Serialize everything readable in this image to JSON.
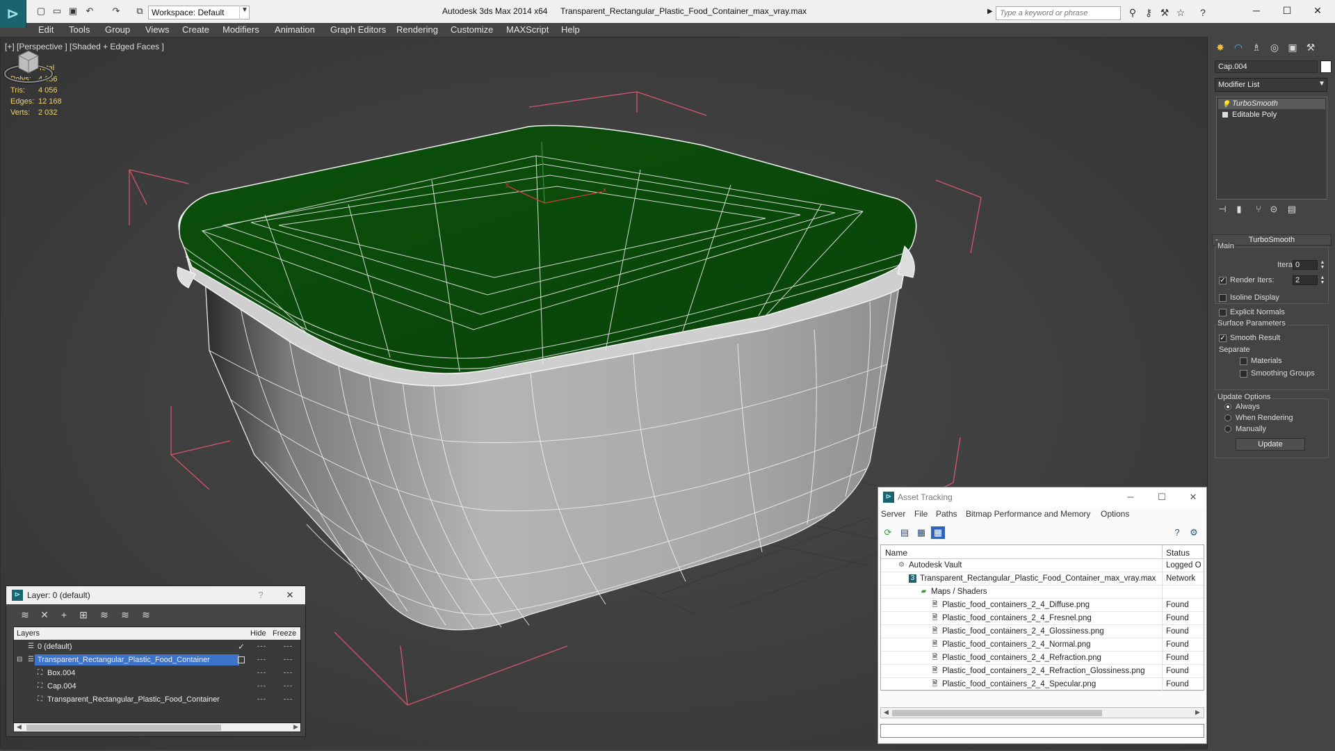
{
  "titlebar": {
    "workspace": "Workspace: Default",
    "app_title": "Autodesk 3ds Max  2014 x64",
    "file_title": "Transparent_Rectangular_Plastic_Food_Container_max_vray.max",
    "search_placeholder": "Type a keyword or phrase"
  },
  "menu": [
    "Edit",
    "Tools",
    "Group",
    "Views",
    "Create",
    "Modifiers",
    "Animation",
    "Graph Editors",
    "Rendering",
    "Customize",
    "MAXScript",
    "Help"
  ],
  "viewport": {
    "label": "[+] [Perspective ] [Shaded + Edged Faces ]",
    "stats": {
      "header": "Total",
      "rows": [
        {
          "label": "Polys:",
          "value": "4 056"
        },
        {
          "label": "Tris:",
          "value": "4 056"
        },
        {
          "label": "Edges:",
          "value": "12 168"
        },
        {
          "label": "Verts:",
          "value": "2 032"
        }
      ]
    },
    "axis_x": "x",
    "axis_y": "y"
  },
  "command_panel": {
    "object_name": "Cap.004",
    "modifier_list": "Modifier List",
    "stack": [
      "TurboSmooth",
      "Editable Poly"
    ],
    "rollout_title": "TurboSmooth",
    "main_group": "Main",
    "iterations_label": "Iterations:",
    "iterations_value": "0",
    "render_iters_label": "Render Iters:",
    "render_iters_value": "2",
    "isoline": "Isoline Display",
    "explicit_normals": "Explicit Normals",
    "surface_group": "Surface Parameters",
    "smooth_result": "Smooth Result",
    "separate": "Separate",
    "materials": "Materials",
    "smoothing_groups": "Smoothing Groups",
    "update_group": "Update Options",
    "always": "Always",
    "when_rendering": "When Rendering",
    "manually": "Manually",
    "update_button": "Update"
  },
  "layer_dialog": {
    "title": "Layer: 0 (default)",
    "help": "?",
    "columns": {
      "layers": "Layers",
      "hide": "Hide",
      "freeze": "Freeze"
    },
    "rows": [
      {
        "name": "0 (default)"
      },
      {
        "name": "Transparent_Rectangular_Plastic_Food_Container"
      },
      {
        "name": "Box.004"
      },
      {
        "name": "Cap.004"
      },
      {
        "name": "Transparent_Rectangular_Plastic_Food_Container"
      }
    ]
  },
  "asset_tracking": {
    "title": "Asset Tracking",
    "menu": [
      "Server",
      "File",
      "Paths",
      "Bitmap Performance and Memory",
      "Options"
    ],
    "columns": {
      "name": "Name",
      "status": "Status"
    },
    "rows": [
      {
        "name": "Autodesk Vault",
        "status": "Logged O"
      },
      {
        "name": "Transparent_Rectangular_Plastic_Food_Container_max_vray.max",
        "status": "Network"
      },
      {
        "name": "Maps / Shaders",
        "status": ""
      },
      {
        "name": "Plastic_food_containers_2_4_Diffuse.png",
        "status": "Found"
      },
      {
        "name": "Plastic_food_containers_2_4_Fresnel.png",
        "status": "Found"
      },
      {
        "name": "Plastic_food_containers_2_4_Glossiness.png",
        "status": "Found"
      },
      {
        "name": "Plastic_food_containers_2_4_Normal.png",
        "status": "Found"
      },
      {
        "name": "Plastic_food_containers_2_4_Refraction.png",
        "status": "Found"
      },
      {
        "name": "Plastic_food_containers_2_4_Refraction_Glossiness.png",
        "status": "Found"
      },
      {
        "name": "Plastic_food_containers_2_4_Specular.png",
        "status": "Found"
      }
    ]
  },
  "colors": {
    "lid_green": "#0f5a0f",
    "wire": "#e8e8e8",
    "bbox": "#d5566f",
    "stats": "#f2d36a",
    "selection": "#3d74c9"
  }
}
